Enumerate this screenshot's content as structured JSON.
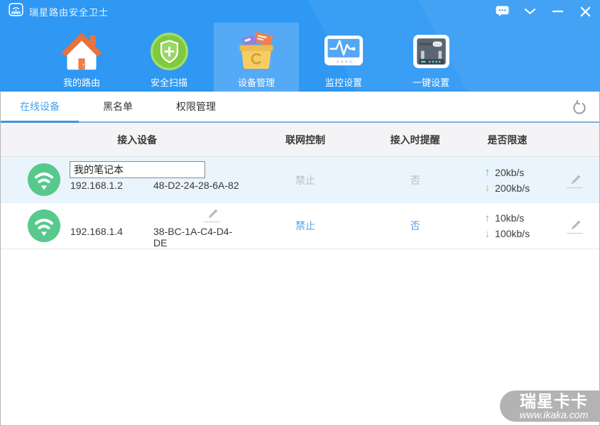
{
  "window": {
    "title": "瑞星路由安全卫士"
  },
  "nav": {
    "items": [
      {
        "label": "我的路由",
        "icon": "home-icon",
        "active": false
      },
      {
        "label": "安全扫描",
        "icon": "shield-scan-icon",
        "active": false
      },
      {
        "label": "设备管理",
        "icon": "toolbox-icon",
        "active": true
      },
      {
        "label": "监控设置",
        "icon": "monitor-icon",
        "active": false
      },
      {
        "label": "一键设置",
        "icon": "router-settings-icon",
        "active": false
      }
    ]
  },
  "tabs": {
    "items": [
      {
        "label": "在线设备",
        "active": true
      },
      {
        "label": "黑名单",
        "active": false
      },
      {
        "label": "权限管理",
        "active": false
      }
    ]
  },
  "table": {
    "headers": [
      "接入设备",
      "联网控制",
      "接入时提醒",
      "是否限速"
    ],
    "up_arrow": "↑",
    "down_arrow": "↓",
    "rows": [
      {
        "name_input": "我的笔记本",
        "ip": "192.168.1.2",
        "mac": "48-D2-24-28-6A-82",
        "control": "禁止",
        "remind": "否",
        "upload": "20kb/s",
        "download": "200kb/s",
        "editing": true
      },
      {
        "ip": "192.168.1.4",
        "mac": "38-BC-1A-C4-D4-DE",
        "control": "禁止",
        "remind": "否",
        "upload": "10kb/s",
        "download": "100kb/s",
        "editing": false
      }
    ]
  },
  "watermark": {
    "brand": "瑞星卡卡",
    "url": "www.ikaka.com"
  },
  "colors": {
    "titlebar_blue": "#2e98f3",
    "nav_active_blue": "#55aaf6",
    "tab_active_blue": "#4aa3e8",
    "row_selected_bg": "#e9f4fc",
    "wifi_green": "#57c98c",
    "link_blue": "#54a2e5",
    "disabled_gray": "#b4bcc4",
    "upload_green": "#6cc24a",
    "download_orange": "#f2a33c",
    "watermark_gray": "#b3b3b3"
  }
}
